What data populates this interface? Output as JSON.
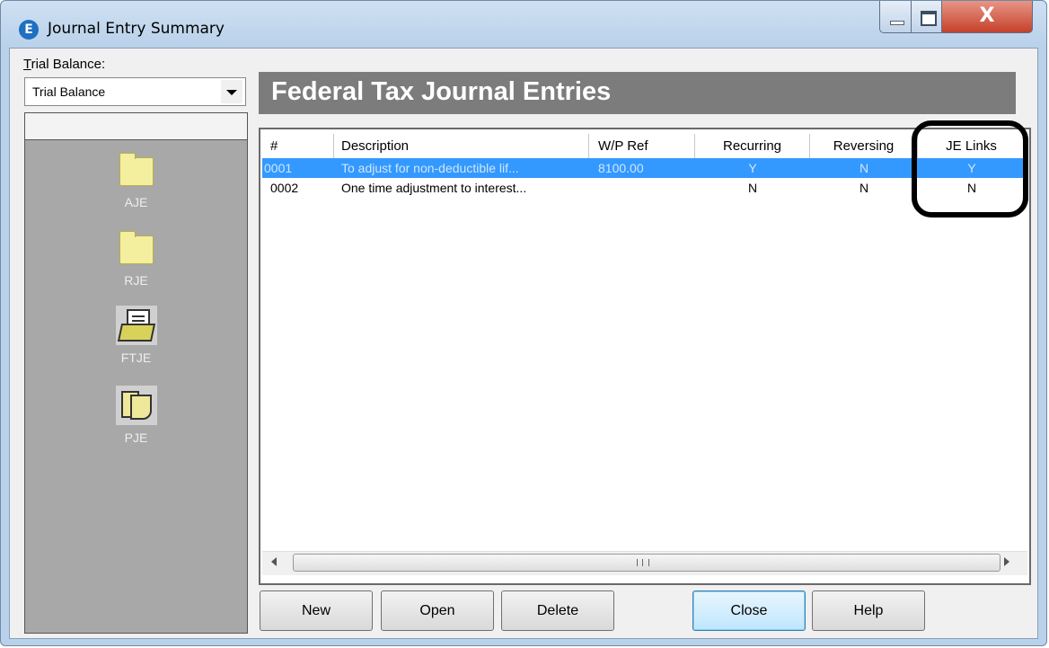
{
  "window": {
    "title": "Journal Entry Summary",
    "app_icon_letter": "E",
    "close_glyph": "X"
  },
  "trial_balance": {
    "label_mnemonic": "T",
    "label_rest": "rial Balance:",
    "selected": "Trial Balance"
  },
  "nav": {
    "items": [
      {
        "label": "AJE",
        "icon": "folder-icon"
      },
      {
        "label": "RJE",
        "icon": "folder-icon"
      },
      {
        "label": "FTJE",
        "icon": "document-folder-icon"
      },
      {
        "label": "PJE",
        "icon": "clipped-pages-icon"
      }
    ]
  },
  "header": {
    "title": "Federal Tax Journal Entries"
  },
  "grid": {
    "columns": [
      "#",
      "Description",
      "W/P Ref",
      "Recurring",
      "Reversing",
      "JE Links"
    ],
    "rows": [
      {
        "num": "0001",
        "description": "To adjust for non-deductible lif...",
        "wp_ref": "8100.00",
        "recurring": "Y",
        "reversing": "N",
        "je_links": "Y",
        "selected": true
      },
      {
        "num": "0002",
        "description": "One time adjustment to interest...",
        "wp_ref": "",
        "recurring": "N",
        "reversing": "N",
        "je_links": "N",
        "selected": false
      }
    ]
  },
  "buttons": {
    "new": "New",
    "open": "Open",
    "delete": "Delete",
    "close": "Close",
    "help": "Help"
  },
  "colors": {
    "selection": "#3399ff",
    "header_bar": "#7c7c7c",
    "nav_panel": "#a8a8a8",
    "annotation": "#000000"
  }
}
